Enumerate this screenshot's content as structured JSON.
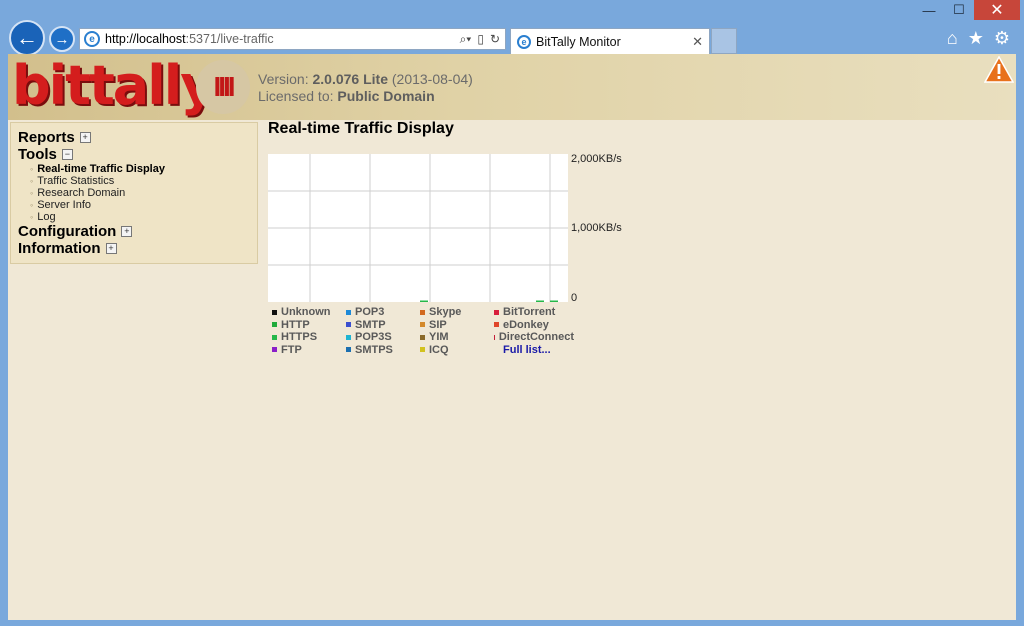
{
  "browser": {
    "url_host": "http://localhost",
    "url_path": ":5371/live-traffic",
    "tab_title": "BitTally Monitor",
    "minimize": "—",
    "maximize": "☐",
    "close": "✕"
  },
  "header": {
    "logo": "bittally",
    "tally_mark": "IIII",
    "version_label": "Version: ",
    "version_value": "2.0.076 Lite",
    "version_date": " (2013-08-04)",
    "license_label": "Licensed to: ",
    "license_value": "Public Domain"
  },
  "sidebar": {
    "reports": "Reports",
    "tools": "Tools",
    "tools_items": [
      "Real-time Traffic Display",
      "Traffic Statistics",
      "Research Domain",
      "Server Info",
      "Log"
    ],
    "configuration": "Configuration",
    "information": "Information"
  },
  "main": {
    "title": "Real-time Traffic Display"
  },
  "chart_data": {
    "type": "line",
    "title": "",
    "y_ticks": [
      "2,000KB/s",
      "1,000KB/s",
      "0"
    ],
    "ylim": [
      0,
      2000
    ],
    "grid": true,
    "series_values": [
      0
    ]
  },
  "legend": {
    "col1": [
      {
        "label": "Unknown",
        "color": "#111111"
      },
      {
        "label": "HTTP",
        "color": "#1faa3b"
      },
      {
        "label": "HTTPS",
        "color": "#25b84a"
      },
      {
        "label": "FTP",
        "color": "#8a1fc9"
      }
    ],
    "col2": [
      {
        "label": "POP3",
        "color": "#1e8ad8"
      },
      {
        "label": "SMTP",
        "color": "#3b4fcf"
      },
      {
        "label": "POP3S",
        "color": "#1fb4d2"
      },
      {
        "label": "SMTPS",
        "color": "#1c6fb0"
      }
    ],
    "col3": [
      {
        "label": "Skype",
        "color": "#d2691e"
      },
      {
        "label": "SIP",
        "color": "#d4892a"
      },
      {
        "label": "YIM",
        "color": "#8b6a2a"
      },
      {
        "label": "ICQ",
        "color": "#d2c21e"
      }
    ],
    "col4": [
      {
        "label": "BitTorrent",
        "color": "#d81e3c"
      },
      {
        "label": "eDonkey",
        "color": "#e0462a"
      },
      {
        "label": "DirectConnect",
        "color": "#c41e3a"
      }
    ],
    "full_list": "Full list..."
  }
}
